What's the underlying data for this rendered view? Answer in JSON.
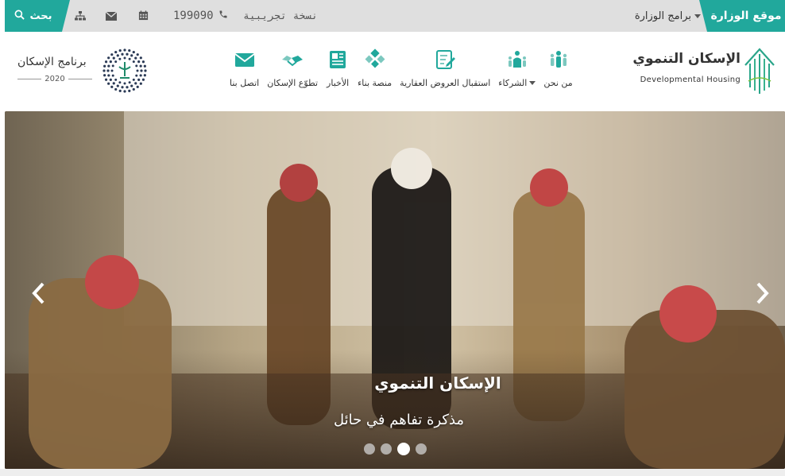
{
  "topbar": {
    "ministry_label": "موقع الوزارة",
    "programs_label": "برامج الوزارة",
    "trial_label": "نسخة تجريبية",
    "phone": "199090",
    "search_label": "بحث"
  },
  "brand": {
    "title": "الإسكان التنموي",
    "subtitle": "Developmental Housing"
  },
  "nav": {
    "items": [
      {
        "label": "من نحن",
        "icon": "people-icon"
      },
      {
        "label": "الشركاء",
        "icon": "partners-icon",
        "has_dropdown": true
      },
      {
        "label": "استقبال العروض العقارية",
        "icon": "document-edit-icon"
      },
      {
        "label": "منصة بناء",
        "icon": "blocks-icon"
      },
      {
        "label": "الأخبار",
        "icon": "newspaper-icon"
      },
      {
        "label": "تطوّع الإسكان",
        "icon": "handshake-icon"
      },
      {
        "label": "اتصل بنا",
        "icon": "envelope-icon"
      }
    ]
  },
  "program": {
    "title": "برنامج الإسكان",
    "year": "2020"
  },
  "hero": {
    "title": "الإسكان التنموي",
    "subtitle": "مذكرة تفاهم في حائل",
    "slide_count": 4,
    "active_slide": 3
  },
  "colors": {
    "accent": "#21a89c",
    "topbar_bg": "#dfdfdf"
  }
}
